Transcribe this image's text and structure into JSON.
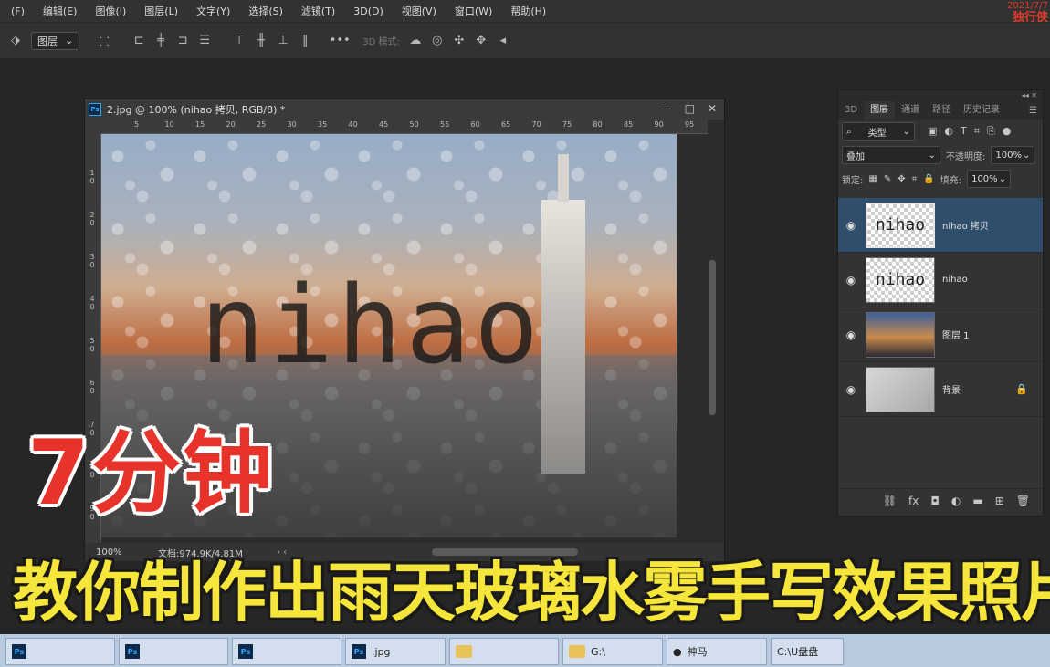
{
  "menu": [
    "(F)",
    "编辑(E)",
    "图像(I)",
    "图层(L)",
    "文字(Y)",
    "选择(S)",
    "滤镜(T)",
    "3D(D)",
    "视图(V)",
    "窗口(W)",
    "帮助(H)"
  ],
  "watermark": {
    "date": "2021/7/7",
    "name": "独行侠"
  },
  "options_bar": {
    "layer_select": "图层",
    "mode_3d_label": "3D 模式:"
  },
  "document": {
    "title": "2.jpg @ 100% (nihao 拷贝, RGB/8) *",
    "ruler_h": [
      "5",
      "10",
      "15",
      "20",
      "25",
      "30",
      "35",
      "40",
      "45",
      "50",
      "55",
      "60",
      "65",
      "70",
      "75",
      "80",
      "85",
      "90",
      "95"
    ],
    "ruler_v": [
      "1\n0",
      "2\n0",
      "3\n0",
      "4\n0",
      "5\n0",
      "6\n0",
      "7\n0",
      "8\n0",
      "9\n0"
    ],
    "canvas_text": "nihao",
    "status_zoom": "100%",
    "status_doc": "文档:974.9K/4.81M"
  },
  "layers_panel": {
    "tabs": [
      "3D",
      "图层",
      "通道",
      "路径",
      "历史记录"
    ],
    "active_tab": "图层",
    "filter_kind": "类型",
    "blend_mode": "叠加",
    "opacity_label": "不透明度:",
    "opacity": "100%",
    "lock_label": "锁定:",
    "fill_label": "填充:",
    "fill": "100%",
    "layers": [
      {
        "name": "nihao 拷贝",
        "thumb_text": "nihao",
        "selected": true
      },
      {
        "name": "nihao",
        "thumb_text": "nihao",
        "selected": false
      },
      {
        "name": "图层 1",
        "thumb_text": "",
        "selected": false
      },
      {
        "name": "背景",
        "thumb_text": "",
        "selected": false
      }
    ]
  },
  "captions": {
    "time": "7分钟",
    "main": "教你制作出雨天玻璃水雾手写效果照片"
  },
  "taskbar": {
    "items": [
      ".jpg",
      "神马",
      "G:\\",
      "C:\\U盘盘"
    ]
  },
  "colors": {
    "selected_layer": "#2f4e6c",
    "caption_red": "#e8332b",
    "caption_yellow": "#f6e53a",
    "ps_blue": "#31a8ff"
  }
}
